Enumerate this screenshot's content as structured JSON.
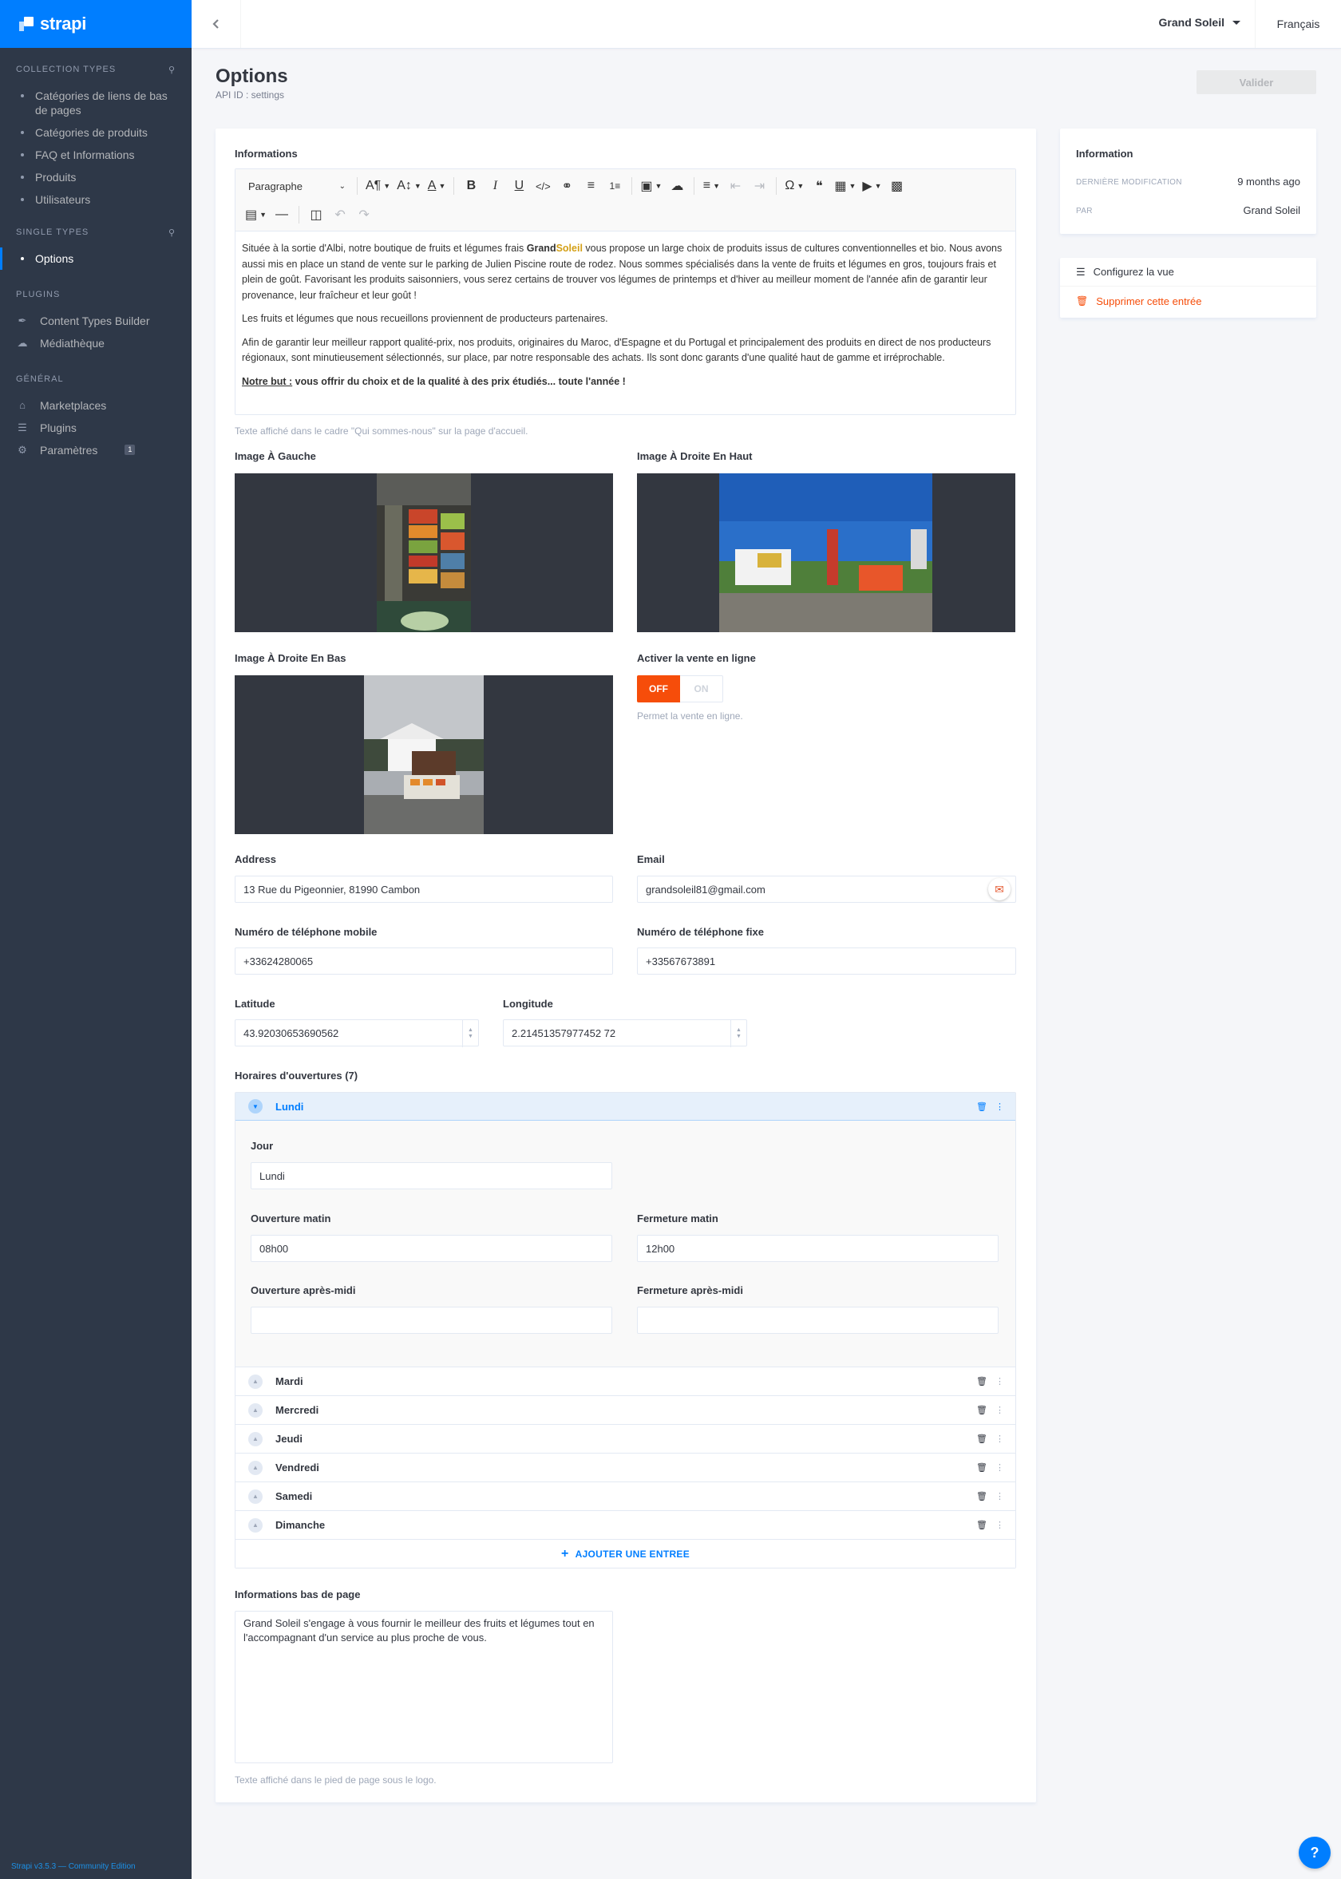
{
  "sidebar": {
    "brand": "strapi",
    "sections": [
      {
        "title": "COLLECTION TYPES",
        "items": [
          "Catégories de liens de bas de pages",
          "Catégories de produits",
          "FAQ et Informations",
          "Produits",
          "Utilisateurs"
        ]
      },
      {
        "title": "SINGLE TYPES",
        "items": [
          "Options"
        ]
      },
      {
        "title": "PLUGINS",
        "items": [
          "Content Types Builder",
          "Médiathèque"
        ]
      },
      {
        "title": "GÉNÉRAL",
        "items": [
          "Marketplaces",
          "Plugins",
          "Paramètres"
        ]
      }
    ],
    "settings_badge": "1",
    "footer": "Strapi v3.5.3 — Community Edition"
  },
  "topbar": {
    "user": "Grand Soleil",
    "locale": "Français"
  },
  "header": {
    "title": "Options",
    "api_id": "API ID : settings",
    "save": "Valider"
  },
  "form": {
    "informations": {
      "label": "Informations",
      "toolbar_paragraph": "Paragraphe",
      "paragraphs": {
        "p1_a": "Située à la sortie d'Albi, notre boutique de fruits et légumes frais ",
        "p1_brand_a": "Grand",
        "p1_brand_b": "Soleil",
        "p1_b": " vous propose un large choix de produits issus de cultures conventionnelles et bio. Nous avons aussi mis en place un stand de vente sur le parking de Julien Piscine route de rodez. Nous sommes spécialisés dans la vente de fruits et légumes en gros, toujours frais et plein de goût. Favorisant les produits saisonniers, vous serez certains de trouver vos légumes de printemps et d'hiver au meilleur moment de l'année afin de garantir leur provenance, leur fraîcheur et leur goût !",
        "p2": "Les fruits et légumes que nous recueillons proviennent de producteurs partenaires.",
        "p3": "Afin de garantir leur meilleur rapport qualité-prix, nos produits, originaires du Maroc, d'Espagne et du Portugal et principalement des produits en direct de nos producteurs régionaux, sont minutieusement sélectionnés, sur place, par notre responsable des achats. Ils sont donc garants d'une qualité haut de gamme et irréprochable.",
        "p4_u": "Notre but :",
        "p4_b": " vous offrir du choix et de la qualité à des prix étudiés... toute l'année !"
      },
      "hint": "Texte affiché dans le cadre \"Qui sommes-nous\" sur la page d'accueil."
    },
    "image_left": "Image À Gauche",
    "image_right_top": "Image À Droite En Haut",
    "image_right_bottom": "Image À Droite En Bas",
    "online_sale": {
      "label": "Activer la vente en ligne",
      "off": "OFF",
      "on": "ON",
      "hint": "Permet la vente en ligne."
    },
    "address": {
      "label": "Address",
      "value": "13 Rue du Pigeonnier, 81990 Cambon"
    },
    "email": {
      "label": "Email",
      "value": "grandsoleil81@gmail.com"
    },
    "mobile": {
      "label": "Numéro de téléphone mobile",
      "value": "+33624280065"
    },
    "phone": {
      "label": "Numéro de téléphone fixe",
      "value": "+33567673891"
    },
    "latitude": {
      "label": "Latitude",
      "value": "43.92030653690562"
    },
    "longitude": {
      "label": "Longitude",
      "value": "2.21451357977452 72"
    },
    "hours": {
      "label": "Horaires d'ouvertures (7)",
      "open_day": "Lundi",
      "fields": {
        "jour_label": "Jour",
        "jour_value": "Lundi",
        "om_label": "Ouverture matin",
        "om_value": "08h00",
        "fm_label": "Fermeture matin",
        "fm_value": "12h00",
        "oa_label": "Ouverture après-midi",
        "oa_value": "",
        "fa_label": "Fermeture après-midi",
        "fa_value": ""
      },
      "days": [
        "Mardi",
        "Mercredi",
        "Jeudi",
        "Vendredi",
        "Samedi",
        "Dimanche"
      ],
      "add": "AJOUTER UNE ENTREE"
    },
    "footer_info": {
      "label": "Informations bas de page",
      "value": "Grand Soleil s'engage à vous fournir le meilleur des fruits et légumes tout en l'accompagnant d'un service au plus proche de vous.",
      "hint": "Texte affiché dans le pied de page sous le logo."
    }
  },
  "info_panel": {
    "title": "Information",
    "modified_label": "DERNIÈRE MODIFICATION",
    "modified_value": "9 months ago",
    "by_label": "PAR",
    "by_value": "Grand Soleil"
  },
  "actions": {
    "configure": "Configurez la vue",
    "delete": "Supprimer cette entrée"
  },
  "help": "?"
}
